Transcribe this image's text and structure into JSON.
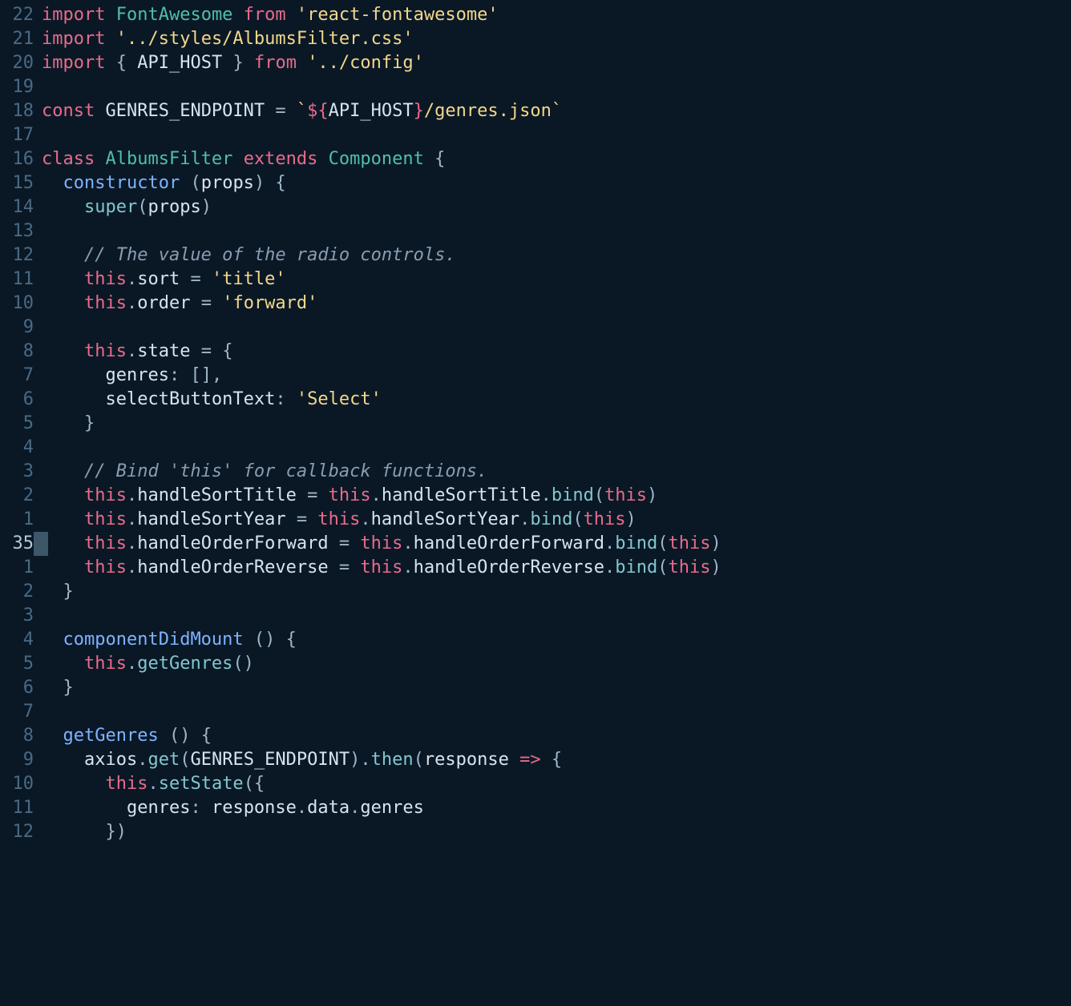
{
  "gutter": [
    "22",
    "21",
    "20",
    "19",
    "18",
    "17",
    "16",
    "15",
    "14",
    "13",
    "12",
    "11",
    "10",
    "9",
    "8",
    "7",
    "6",
    "5",
    "4",
    "3",
    "2",
    "1",
    "35",
    "1",
    "2",
    "3",
    "4",
    "5",
    "6",
    "7",
    "8",
    "9",
    "10",
    "11",
    "12"
  ],
  "current_line_index": 22,
  "code": {
    "l0": [
      [
        "kw",
        "import"
      ],
      [
        "pun",
        " "
      ],
      [
        "type",
        "FontAwesome"
      ],
      [
        "pun",
        " "
      ],
      [
        "kw",
        "from"
      ],
      [
        "pun",
        " "
      ],
      [
        "str",
        "'react-fontawesome'"
      ]
    ],
    "l1": [
      [
        "kw",
        "import"
      ],
      [
        "pun",
        " "
      ],
      [
        "str",
        "'../styles/AlbumsFilter.css'"
      ]
    ],
    "l2": [
      [
        "kw",
        "import"
      ],
      [
        "pun",
        " { "
      ],
      [
        "id",
        "API_HOST"
      ],
      [
        "pun",
        " } "
      ],
      [
        "kw",
        "from"
      ],
      [
        "pun",
        " "
      ],
      [
        "str",
        "'../config'"
      ]
    ],
    "l3": [],
    "l4": [
      [
        "kw",
        "const"
      ],
      [
        "pun",
        " "
      ],
      [
        "id",
        "GENRES_ENDPOINT"
      ],
      [
        "pun",
        " = "
      ],
      [
        "tmpl",
        "`"
      ],
      [
        "tmplvar",
        "${"
      ],
      [
        "tmplid",
        "API_HOST"
      ],
      [
        "tmplvar",
        "}"
      ],
      [
        "tmpl",
        "/genres.json`"
      ]
    ],
    "l5": [],
    "l6": [
      [
        "kw",
        "class"
      ],
      [
        "pun",
        " "
      ],
      [
        "type",
        "AlbumsFilter"
      ],
      [
        "pun",
        " "
      ],
      [
        "kw",
        "extends"
      ],
      [
        "pun",
        " "
      ],
      [
        "type",
        "Component"
      ],
      [
        "pun",
        " {"
      ]
    ],
    "l7": [
      [
        "pun",
        "  "
      ],
      [
        "kw2",
        "constructor"
      ],
      [
        "pun",
        " ("
      ],
      [
        "id",
        "props"
      ],
      [
        "pun",
        ") {"
      ]
    ],
    "l8": [
      [
        "pun",
        "    "
      ],
      [
        "fn",
        "super"
      ],
      [
        "pun",
        "("
      ],
      [
        "id",
        "props"
      ],
      [
        "pun",
        ")"
      ]
    ],
    "l9": [],
    "l10": [
      [
        "pun",
        "    "
      ],
      [
        "cmt",
        "// The value of the radio controls."
      ]
    ],
    "l11": [
      [
        "pun",
        "    "
      ],
      [
        "kw",
        "this"
      ],
      [
        "pun",
        "."
      ],
      [
        "prop",
        "sort"
      ],
      [
        "pun",
        " = "
      ],
      [
        "str",
        "'title'"
      ]
    ],
    "l12": [
      [
        "pun",
        "    "
      ],
      [
        "kw",
        "this"
      ],
      [
        "pun",
        "."
      ],
      [
        "prop",
        "order"
      ],
      [
        "pun",
        " = "
      ],
      [
        "str",
        "'forward'"
      ]
    ],
    "l13": [],
    "l14": [
      [
        "pun",
        "    "
      ],
      [
        "kw",
        "this"
      ],
      [
        "pun",
        "."
      ],
      [
        "prop",
        "state"
      ],
      [
        "pun",
        " = {"
      ]
    ],
    "l15": [
      [
        "pun",
        "      "
      ],
      [
        "prop",
        "genres"
      ],
      [
        "pun",
        ": [],"
      ]
    ],
    "l16": [
      [
        "pun",
        "      "
      ],
      [
        "prop",
        "selectButtonText"
      ],
      [
        "pun",
        ": "
      ],
      [
        "str",
        "'Select'"
      ]
    ],
    "l17": [
      [
        "pun",
        "    }"
      ]
    ],
    "l18": [],
    "l19": [
      [
        "pun",
        "    "
      ],
      [
        "cmt",
        "// Bind 'this' for callback functions."
      ]
    ],
    "l20": [
      [
        "pun",
        "    "
      ],
      [
        "kw",
        "this"
      ],
      [
        "pun",
        "."
      ],
      [
        "prop",
        "handleSortTitle"
      ],
      [
        "pun",
        " = "
      ],
      [
        "kw",
        "this"
      ],
      [
        "pun",
        "."
      ],
      [
        "prop",
        "handleSortTitle"
      ],
      [
        "pun",
        "."
      ],
      [
        "fn",
        "bind"
      ],
      [
        "pun",
        "("
      ],
      [
        "kw",
        "this"
      ],
      [
        "pun",
        ")"
      ]
    ],
    "l21": [
      [
        "pun",
        "    "
      ],
      [
        "kw",
        "this"
      ],
      [
        "pun",
        "."
      ],
      [
        "prop",
        "handleSortYear"
      ],
      [
        "pun",
        " = "
      ],
      [
        "kw",
        "this"
      ],
      [
        "pun",
        "."
      ],
      [
        "prop",
        "handleSortYear"
      ],
      [
        "pun",
        "."
      ],
      [
        "fn",
        "bind"
      ],
      [
        "pun",
        "("
      ],
      [
        "kw",
        "this"
      ],
      [
        "pun",
        ")"
      ]
    ],
    "l22": [
      [
        "pun",
        "    "
      ],
      [
        "kw",
        "this"
      ],
      [
        "pun",
        "."
      ],
      [
        "prop",
        "handleOrderForward"
      ],
      [
        "pun",
        " = "
      ],
      [
        "kw",
        "this"
      ],
      [
        "pun",
        "."
      ],
      [
        "prop",
        "handleOrderForward"
      ],
      [
        "pun",
        "."
      ],
      [
        "fn",
        "bind"
      ],
      [
        "pun",
        "("
      ],
      [
        "kw",
        "this"
      ],
      [
        "pun",
        ")"
      ]
    ],
    "l23": [
      [
        "pun",
        "    "
      ],
      [
        "kw",
        "this"
      ],
      [
        "pun",
        "."
      ],
      [
        "prop",
        "handleOrderReverse"
      ],
      [
        "pun",
        " = "
      ],
      [
        "kw",
        "this"
      ],
      [
        "pun",
        "."
      ],
      [
        "prop",
        "handleOrderReverse"
      ],
      [
        "pun",
        "."
      ],
      [
        "fn",
        "bind"
      ],
      [
        "pun",
        "("
      ],
      [
        "kw",
        "this"
      ],
      [
        "pun",
        ")"
      ]
    ],
    "l24": [
      [
        "pun",
        "  }"
      ]
    ],
    "l25": [],
    "l26": [
      [
        "pun",
        "  "
      ],
      [
        "kw2",
        "componentDidMount"
      ],
      [
        "pun",
        " () {"
      ]
    ],
    "l27": [
      [
        "pun",
        "    "
      ],
      [
        "kw",
        "this"
      ],
      [
        "pun",
        "."
      ],
      [
        "fn",
        "getGenres"
      ],
      [
        "pun",
        "()"
      ]
    ],
    "l28": [
      [
        "pun",
        "  }"
      ]
    ],
    "l29": [],
    "l30": [
      [
        "pun",
        "  "
      ],
      [
        "kw2",
        "getGenres"
      ],
      [
        "pun",
        " () {"
      ]
    ],
    "l31": [
      [
        "pun",
        "    "
      ],
      [
        "id",
        "axios"
      ],
      [
        "pun",
        "."
      ],
      [
        "fn",
        "get"
      ],
      [
        "pun",
        "("
      ],
      [
        "id",
        "GENRES_ENDPOINT"
      ],
      [
        "pun",
        ")."
      ],
      [
        "fn",
        "then"
      ],
      [
        "pun",
        "("
      ],
      [
        "id",
        "response"
      ],
      [
        "pun",
        " "
      ],
      [
        "arrow",
        "=>"
      ],
      [
        "pun",
        " {"
      ]
    ],
    "l32": [
      [
        "pun",
        "      "
      ],
      [
        "kw",
        "this"
      ],
      [
        "pun",
        "."
      ],
      [
        "fn",
        "setState"
      ],
      [
        "pun",
        "({"
      ]
    ],
    "l33": [
      [
        "pun",
        "        "
      ],
      [
        "prop",
        "genres"
      ],
      [
        "pun",
        ": "
      ],
      [
        "id",
        "response"
      ],
      [
        "pun",
        "."
      ],
      [
        "prop",
        "data"
      ],
      [
        "pun",
        "."
      ],
      [
        "prop",
        "genres"
      ]
    ],
    "l34": [
      [
        "pun",
        "      })"
      ]
    ]
  }
}
